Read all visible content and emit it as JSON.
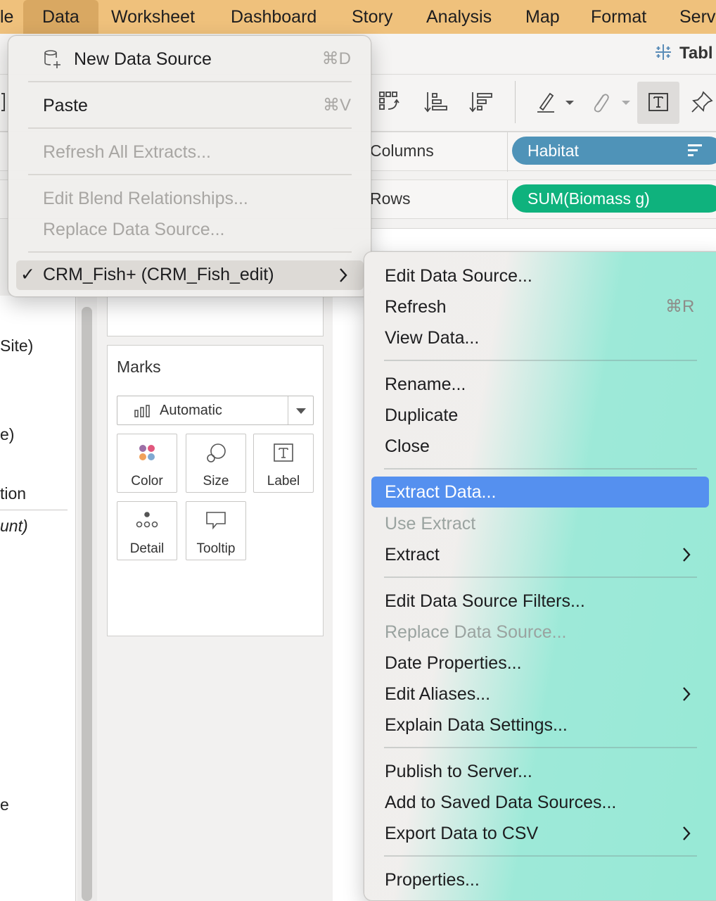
{
  "menubar": {
    "items": [
      "le",
      "Data",
      "Worksheet",
      "Dashboard",
      "Story",
      "Analysis",
      "Map",
      "Format",
      "Serv"
    ],
    "active": "Data"
  },
  "app": {
    "title": "Tabl"
  },
  "shelves": {
    "columns_label": "Columns",
    "rows_label": "Rows",
    "columns_pill": "Habitat",
    "rows_pill": "SUM(Biomass g)"
  },
  "data_pane": {
    "lines": [
      "Site)",
      "e)",
      "tion",
      "unt)",
      "e"
    ]
  },
  "marks_card": {
    "title": "Marks",
    "mark_type": "Automatic",
    "buttons": [
      "Color",
      "Size",
      "Label",
      "Detail",
      "Tooltip"
    ]
  },
  "data_menu": {
    "new_data_source": "New Data Source",
    "new_data_source_shortcut": "⌘D",
    "paste": "Paste",
    "paste_shortcut": "⌘V",
    "refresh_all_extracts": "Refresh All Extracts...",
    "edit_blend_relationships": "Edit Blend Relationships...",
    "replace_data_source": "Replace Data Source...",
    "data_source_entry": "CRM_Fish+ (CRM_Fish_edit)",
    "checkmark": "✓"
  },
  "sub_menu": {
    "edit_data_source": "Edit Data Source...",
    "refresh": "Refresh",
    "refresh_shortcut": "⌘R",
    "view_data": "View Data...",
    "rename": "Rename...",
    "duplicate": "Duplicate",
    "close": "Close",
    "extract_data": "Extract Data...",
    "use_extract": "Use Extract",
    "extract": "Extract",
    "edit_data_source_filters": "Edit Data Source Filters...",
    "replace_data_source": "Replace Data Source...",
    "date_properties": "Date Properties...",
    "edit_aliases": "Edit Aliases...",
    "explain_data_settings": "Explain Data Settings...",
    "publish_to_server": "Publish to Server...",
    "add_to_saved_data_sources": "Add to Saved Data Sources...",
    "export_data_to_csv": "Export Data to CSV",
    "properties": "Properties..."
  },
  "colors": {
    "menubar": "#efc17c",
    "columns_pill": "#4f93b8",
    "rows_pill": "#0fb27d",
    "selection": "#5590ef"
  }
}
